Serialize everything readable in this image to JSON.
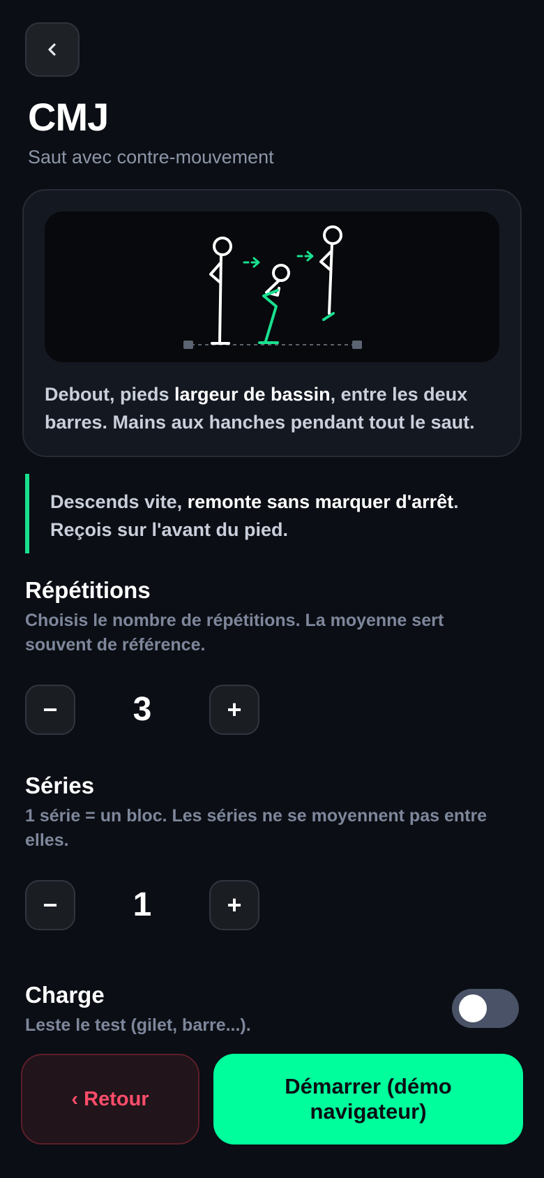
{
  "header": {
    "back_icon": "chevron-left-icon",
    "title": "CMJ",
    "subtitle": "Saut avec contre-mouvement"
  },
  "card": {
    "illustration_icon": "cmj-jump-sequence-illustration",
    "text_1": "Debout, pieds ",
    "text_bold": "largeur de bassin",
    "text_2": ", entre les deux barres. Mains aux hanches pendant tout le saut."
  },
  "tip": {
    "text_1": "Descends vite, ",
    "text_bold": "remonte sans marquer d'arrêt",
    "text_2": ". Reçois sur l'avant du pied."
  },
  "repetitions": {
    "title": "Répétitions",
    "description": "Choisis le nombre de répétitions. La moyenne sert souvent de référence.",
    "minus_label": "−",
    "value": "3",
    "plus_label": "+"
  },
  "series": {
    "title": "Séries",
    "description": "1 série = un bloc. Les séries ne se moyennent pas entre elles.",
    "minus_label": "−",
    "value": "1",
    "plus_label": "+"
  },
  "charge": {
    "title": "Charge",
    "description": "Leste le test (gilet, barre...).",
    "enabled": false
  },
  "footer": {
    "back_label": "‹ Retour",
    "start_label": "Démarrer (démo navigateur)"
  },
  "colors": {
    "background": "#0b0e14",
    "accent": "#00ff9c",
    "tip_border": "#19e08f",
    "danger": "#ff4d6a"
  }
}
